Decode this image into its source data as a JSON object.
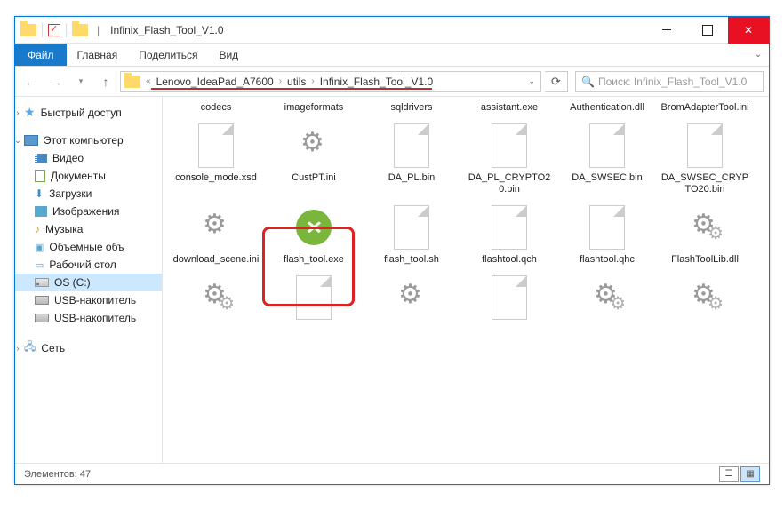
{
  "title": "Infinix_Flash_Tool_V1.0",
  "ribbon": {
    "file": "Файл",
    "tabs": [
      "Главная",
      "Поделиться",
      "Вид"
    ]
  },
  "breadcrumbs": [
    "Lenovo_IdeaPad_A7600",
    "utils",
    "Infinix_Flash_Tool_V1.0"
  ],
  "search": {
    "placeholder": "Поиск: Infinix_Flash_Tool_V1.0"
  },
  "sidebar": {
    "quick": "Быстрый доступ",
    "pc": "Этот компьютер",
    "items": [
      "Видео",
      "Документы",
      "Загрузки",
      "Изображения",
      "Музыка",
      "Объемные объ",
      "Рабочий стол",
      "OS (C:)",
      "USB-накопитель",
      "USB-накопитель"
    ],
    "net": "Сеть"
  },
  "files": {
    "row0": [
      "codecs",
      "imageformats",
      "sqldrivers",
      "assistant.exe",
      "Authentication.dll",
      "BromAdapterTool.ini"
    ],
    "row1": [
      "console_mode.xsd",
      "CustPT.ini",
      "DA_PL.bin",
      "DA_PL_CRYPTO20.bin",
      "DA_SWSEC.bin",
      "DA_SWSEC_CRYPTO20.bin"
    ],
    "row2": [
      "download_scene.ini",
      "flash_tool.exe",
      "flash_tool.sh",
      "flashtool.qch",
      "flashtool.qhc",
      "FlashToolLib.dll"
    ],
    "row3": [
      "",
      "",
      "",
      "",
      "",
      ""
    ]
  },
  "status": {
    "count": "Элементов: 47"
  }
}
